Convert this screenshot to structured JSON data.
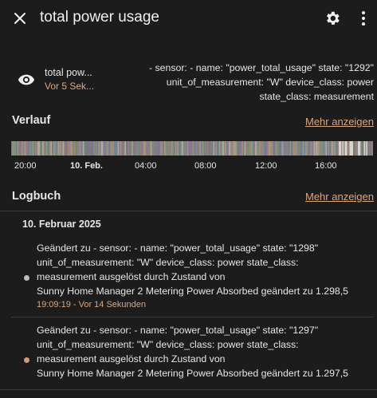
{
  "header": {
    "title": "total power usage",
    "close_icon": "close-icon",
    "settings_icon": "gear-icon",
    "menu_icon": "more-vertical-icon"
  },
  "entity": {
    "icon": "eye-icon",
    "name": "total pow...",
    "last_changed": "Vor 5 Sek...",
    "state_lines": [
      "- sensor: - name: \"power_total_usage\" state: \"1292\"",
      "unit_of_measurement: \"W\" device_class: power",
      "state_class: measurement"
    ]
  },
  "history": {
    "title": "Verlauf",
    "more_label": "Mehr anzeigen",
    "axis_labels": [
      "20:00",
      "10. Feb.",
      "04:00",
      "08:00",
      "12:00",
      "16:00"
    ]
  },
  "logbook": {
    "title": "Logbuch",
    "more_label": "Mehr anzeigen",
    "date": "10. Februar 2025",
    "entries": [
      {
        "lines": [
          "Geändert zu - sensor: - name: \"power_total_usage\" state: \"1298\"",
          "unit_of_measurement: \"W\" device_class: power state_class:",
          "measurement ausgelöst durch Zustand von",
          "Sunny Home Manager 2 Metering Power Absorbed geändert zu 1.298,5"
        ],
        "time": "19:09:19 - Vor 14 Sekunden",
        "dot_color": "#bdbdbd"
      },
      {
        "lines": [
          "Geändert zu - sensor: - name: \"power_total_usage\" state: \"1297\"",
          "unit_of_measurement: \"W\" device_class: power state_class:",
          "measurement ausgelöst durch Zustand von",
          "Sunny Home Manager 2 Metering Power Absorbed geändert zu 1.297,5"
        ],
        "dot_color": "#d49a7d"
      }
    ]
  },
  "colors": {
    "background": "#1c1c1c",
    "accent": "#d9a77c",
    "text": "#e6e6e6"
  }
}
